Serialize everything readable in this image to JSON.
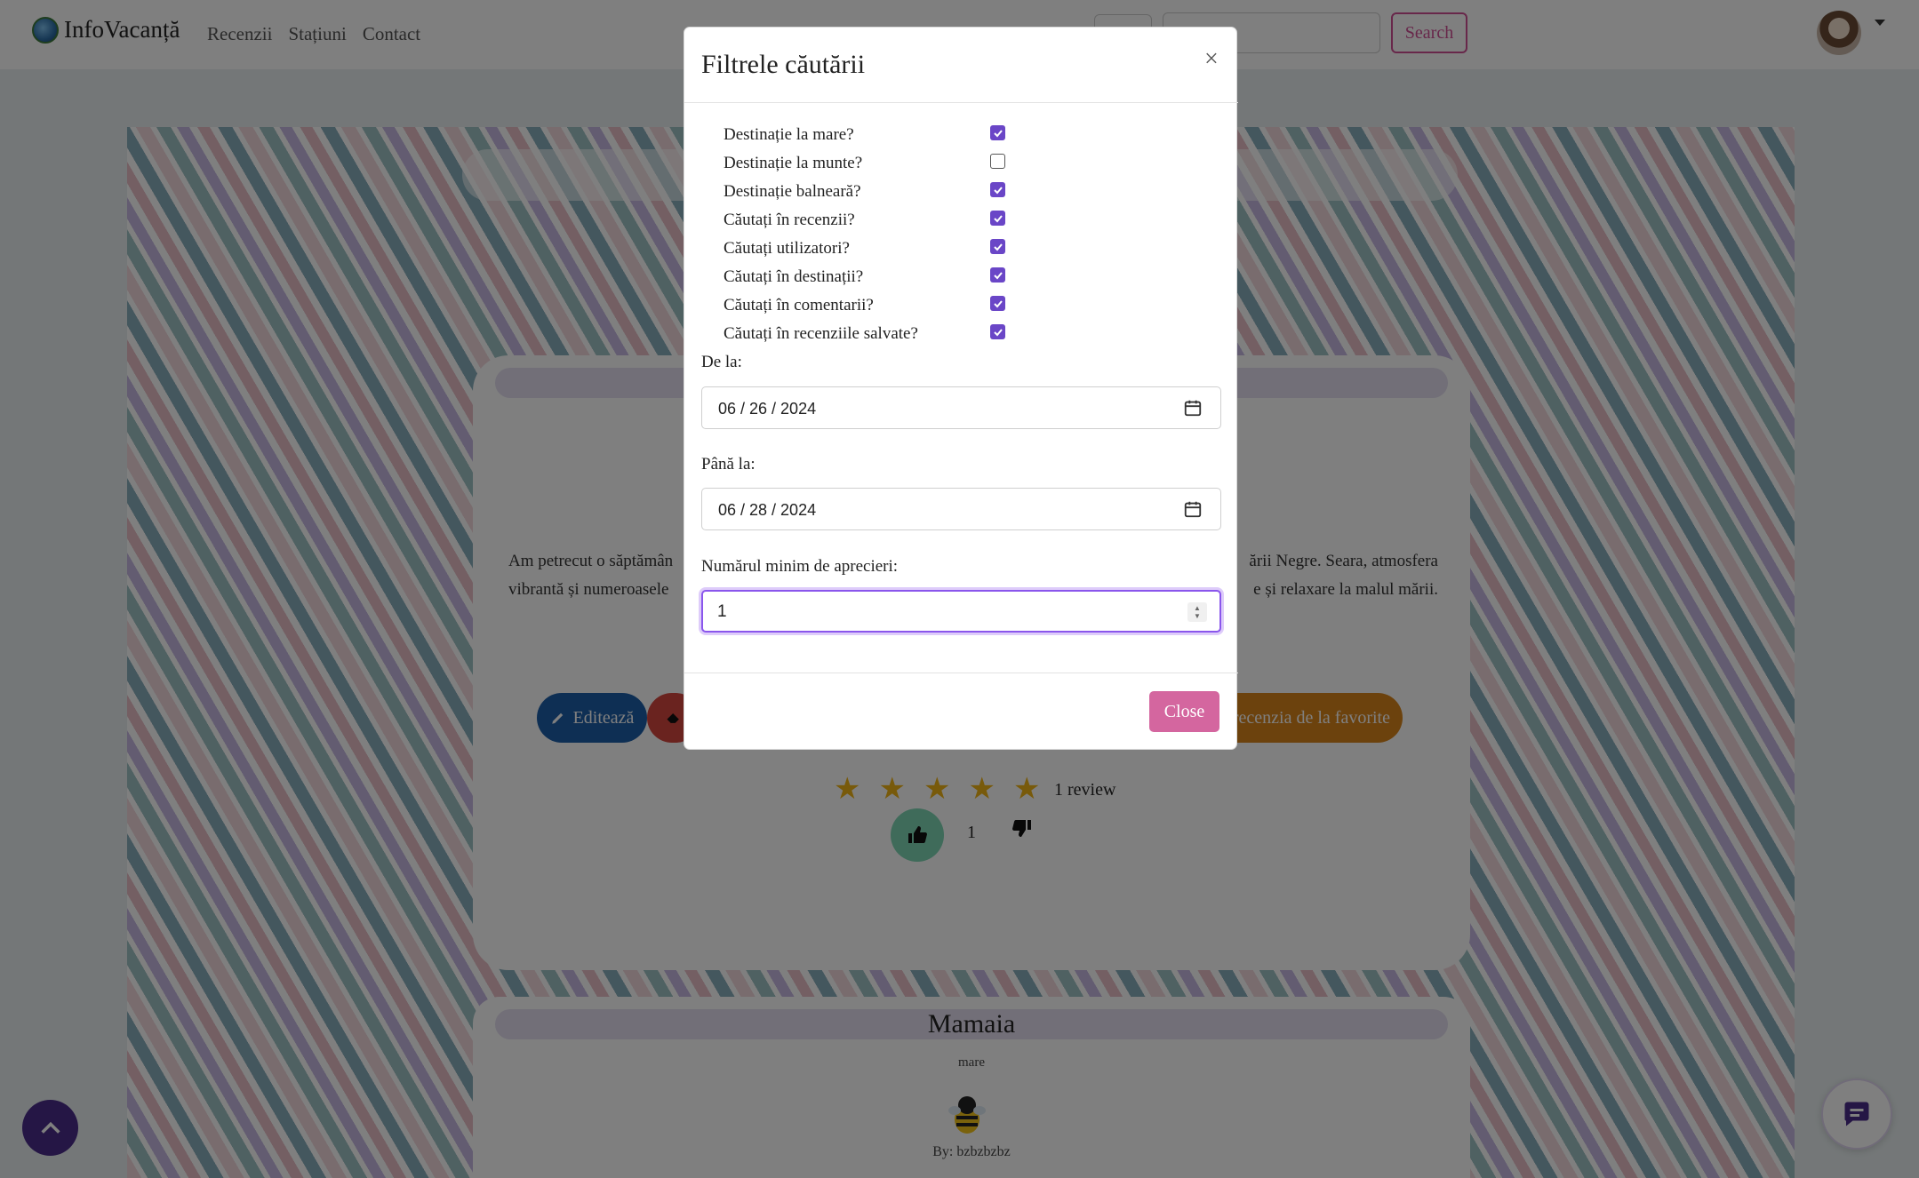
{
  "navbar": {
    "brand": "InfoVacanță",
    "links": [
      "Recenzii",
      "Stațiuni",
      "Contact"
    ],
    "search_label": "Search"
  },
  "review": {
    "text_left_1": "Am petrecut o săptămân",
    "text_right_1": "ării Negre. Seara, atmosfera",
    "text_left_2": "vibrantă și numeroasele",
    "text_right_2": "e și relaxare la malul mării.",
    "edit_label": "Editează",
    "fav_label": "recenzia de la favorite",
    "stars": 5,
    "review_count": "1 review",
    "likes": "1"
  },
  "mamaia": {
    "title": "Mamaia",
    "tag": "mare",
    "author": "By: bzbzbzbz"
  },
  "modal": {
    "title": "Filtrele căutării",
    "close_symbol": "×",
    "checks": [
      {
        "label": "Destinație la mare?",
        "checked": true
      },
      {
        "label": "Destinație la munte?",
        "checked": false
      },
      {
        "label": "Destinație balneară?",
        "checked": true
      },
      {
        "label": "Căutați în recenzii?",
        "checked": true
      },
      {
        "label": "Căutați utilizatori?",
        "checked": true
      },
      {
        "label": "Căutați în destinații?",
        "checked": true
      },
      {
        "label": "Căutați în comentarii?",
        "checked": true
      },
      {
        "label": "Căutați în recenziile salvate?",
        "checked": true
      }
    ],
    "from_label": "De la:",
    "from_value": "06 / 26 / 2024",
    "to_label": "Până la:",
    "to_value": "06 / 28 / 2024",
    "min_likes_label": "Numărul minim de aprecieri:",
    "min_likes_value": "1",
    "close_button": "Close"
  },
  "colors": {
    "accent": "#6a46c7",
    "close_button": "#d4669f",
    "search_border": "#d04f95"
  }
}
